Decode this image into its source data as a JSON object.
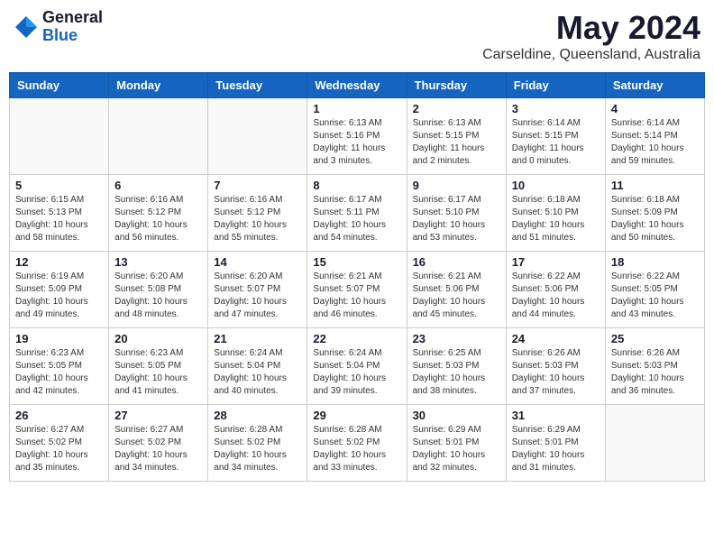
{
  "logo": {
    "general": "General",
    "blue": "Blue"
  },
  "title": "May 2024",
  "location": "Carseldine, Queensland, Australia",
  "days_of_week": [
    "Sunday",
    "Monday",
    "Tuesday",
    "Wednesday",
    "Thursday",
    "Friday",
    "Saturday"
  ],
  "weeks": [
    [
      {
        "day": "",
        "info": ""
      },
      {
        "day": "",
        "info": ""
      },
      {
        "day": "",
        "info": ""
      },
      {
        "day": "1",
        "info": "Sunrise: 6:13 AM\nSunset: 5:16 PM\nDaylight: 11 hours\nand 3 minutes."
      },
      {
        "day": "2",
        "info": "Sunrise: 6:13 AM\nSunset: 5:15 PM\nDaylight: 11 hours\nand 2 minutes."
      },
      {
        "day": "3",
        "info": "Sunrise: 6:14 AM\nSunset: 5:15 PM\nDaylight: 11 hours\nand 0 minutes."
      },
      {
        "day": "4",
        "info": "Sunrise: 6:14 AM\nSunset: 5:14 PM\nDaylight: 10 hours\nand 59 minutes."
      }
    ],
    [
      {
        "day": "5",
        "info": "Sunrise: 6:15 AM\nSunset: 5:13 PM\nDaylight: 10 hours\nand 58 minutes."
      },
      {
        "day": "6",
        "info": "Sunrise: 6:16 AM\nSunset: 5:12 PM\nDaylight: 10 hours\nand 56 minutes."
      },
      {
        "day": "7",
        "info": "Sunrise: 6:16 AM\nSunset: 5:12 PM\nDaylight: 10 hours\nand 55 minutes."
      },
      {
        "day": "8",
        "info": "Sunrise: 6:17 AM\nSunset: 5:11 PM\nDaylight: 10 hours\nand 54 minutes."
      },
      {
        "day": "9",
        "info": "Sunrise: 6:17 AM\nSunset: 5:10 PM\nDaylight: 10 hours\nand 53 minutes."
      },
      {
        "day": "10",
        "info": "Sunrise: 6:18 AM\nSunset: 5:10 PM\nDaylight: 10 hours\nand 51 minutes."
      },
      {
        "day": "11",
        "info": "Sunrise: 6:18 AM\nSunset: 5:09 PM\nDaylight: 10 hours\nand 50 minutes."
      }
    ],
    [
      {
        "day": "12",
        "info": "Sunrise: 6:19 AM\nSunset: 5:09 PM\nDaylight: 10 hours\nand 49 minutes."
      },
      {
        "day": "13",
        "info": "Sunrise: 6:20 AM\nSunset: 5:08 PM\nDaylight: 10 hours\nand 48 minutes."
      },
      {
        "day": "14",
        "info": "Sunrise: 6:20 AM\nSunset: 5:07 PM\nDaylight: 10 hours\nand 47 minutes."
      },
      {
        "day": "15",
        "info": "Sunrise: 6:21 AM\nSunset: 5:07 PM\nDaylight: 10 hours\nand 46 minutes."
      },
      {
        "day": "16",
        "info": "Sunrise: 6:21 AM\nSunset: 5:06 PM\nDaylight: 10 hours\nand 45 minutes."
      },
      {
        "day": "17",
        "info": "Sunrise: 6:22 AM\nSunset: 5:06 PM\nDaylight: 10 hours\nand 44 minutes."
      },
      {
        "day": "18",
        "info": "Sunrise: 6:22 AM\nSunset: 5:05 PM\nDaylight: 10 hours\nand 43 minutes."
      }
    ],
    [
      {
        "day": "19",
        "info": "Sunrise: 6:23 AM\nSunset: 5:05 PM\nDaylight: 10 hours\nand 42 minutes."
      },
      {
        "day": "20",
        "info": "Sunrise: 6:23 AM\nSunset: 5:05 PM\nDaylight: 10 hours\nand 41 minutes."
      },
      {
        "day": "21",
        "info": "Sunrise: 6:24 AM\nSunset: 5:04 PM\nDaylight: 10 hours\nand 40 minutes."
      },
      {
        "day": "22",
        "info": "Sunrise: 6:24 AM\nSunset: 5:04 PM\nDaylight: 10 hours\nand 39 minutes."
      },
      {
        "day": "23",
        "info": "Sunrise: 6:25 AM\nSunset: 5:03 PM\nDaylight: 10 hours\nand 38 minutes."
      },
      {
        "day": "24",
        "info": "Sunrise: 6:26 AM\nSunset: 5:03 PM\nDaylight: 10 hours\nand 37 minutes."
      },
      {
        "day": "25",
        "info": "Sunrise: 6:26 AM\nSunset: 5:03 PM\nDaylight: 10 hours\nand 36 minutes."
      }
    ],
    [
      {
        "day": "26",
        "info": "Sunrise: 6:27 AM\nSunset: 5:02 PM\nDaylight: 10 hours\nand 35 minutes."
      },
      {
        "day": "27",
        "info": "Sunrise: 6:27 AM\nSunset: 5:02 PM\nDaylight: 10 hours\nand 34 minutes."
      },
      {
        "day": "28",
        "info": "Sunrise: 6:28 AM\nSunset: 5:02 PM\nDaylight: 10 hours\nand 34 minutes."
      },
      {
        "day": "29",
        "info": "Sunrise: 6:28 AM\nSunset: 5:02 PM\nDaylight: 10 hours\nand 33 minutes."
      },
      {
        "day": "30",
        "info": "Sunrise: 6:29 AM\nSunset: 5:01 PM\nDaylight: 10 hours\nand 32 minutes."
      },
      {
        "day": "31",
        "info": "Sunrise: 6:29 AM\nSunset: 5:01 PM\nDaylight: 10 hours\nand 31 minutes."
      },
      {
        "day": "",
        "info": ""
      }
    ]
  ]
}
